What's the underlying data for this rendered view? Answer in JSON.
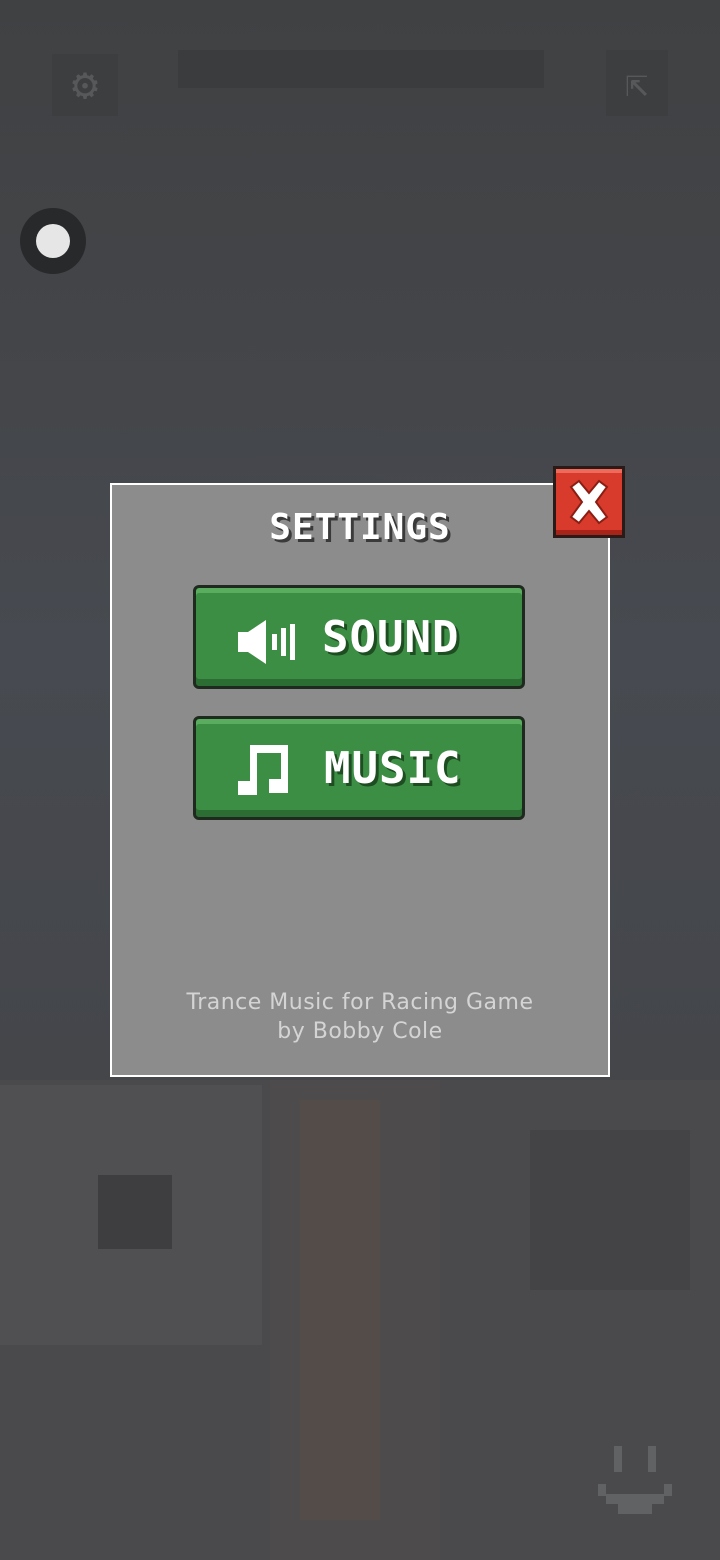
{
  "hud": {
    "settings_icon": "gear-icon",
    "exit_icon": "exit-icon",
    "joystick_icon": "joystick-icon",
    "emote_icon": "smiley-icon"
  },
  "settings_dialog": {
    "title": "SETTINGS",
    "close_icon": "close-x-icon",
    "buttons": [
      {
        "label": "SOUND",
        "icon": "speaker-icon"
      },
      {
        "label": "MUSIC",
        "icon": "music-note-icon"
      }
    ],
    "credits": {
      "line1": "Trance Music for Racing Game",
      "line2": "by Bobby Cole"
    }
  },
  "colors": {
    "dialog_bg": "#8c8c8c",
    "button_green": "#3d8e45",
    "close_red": "#d83a2b",
    "overlay": "#454749"
  }
}
